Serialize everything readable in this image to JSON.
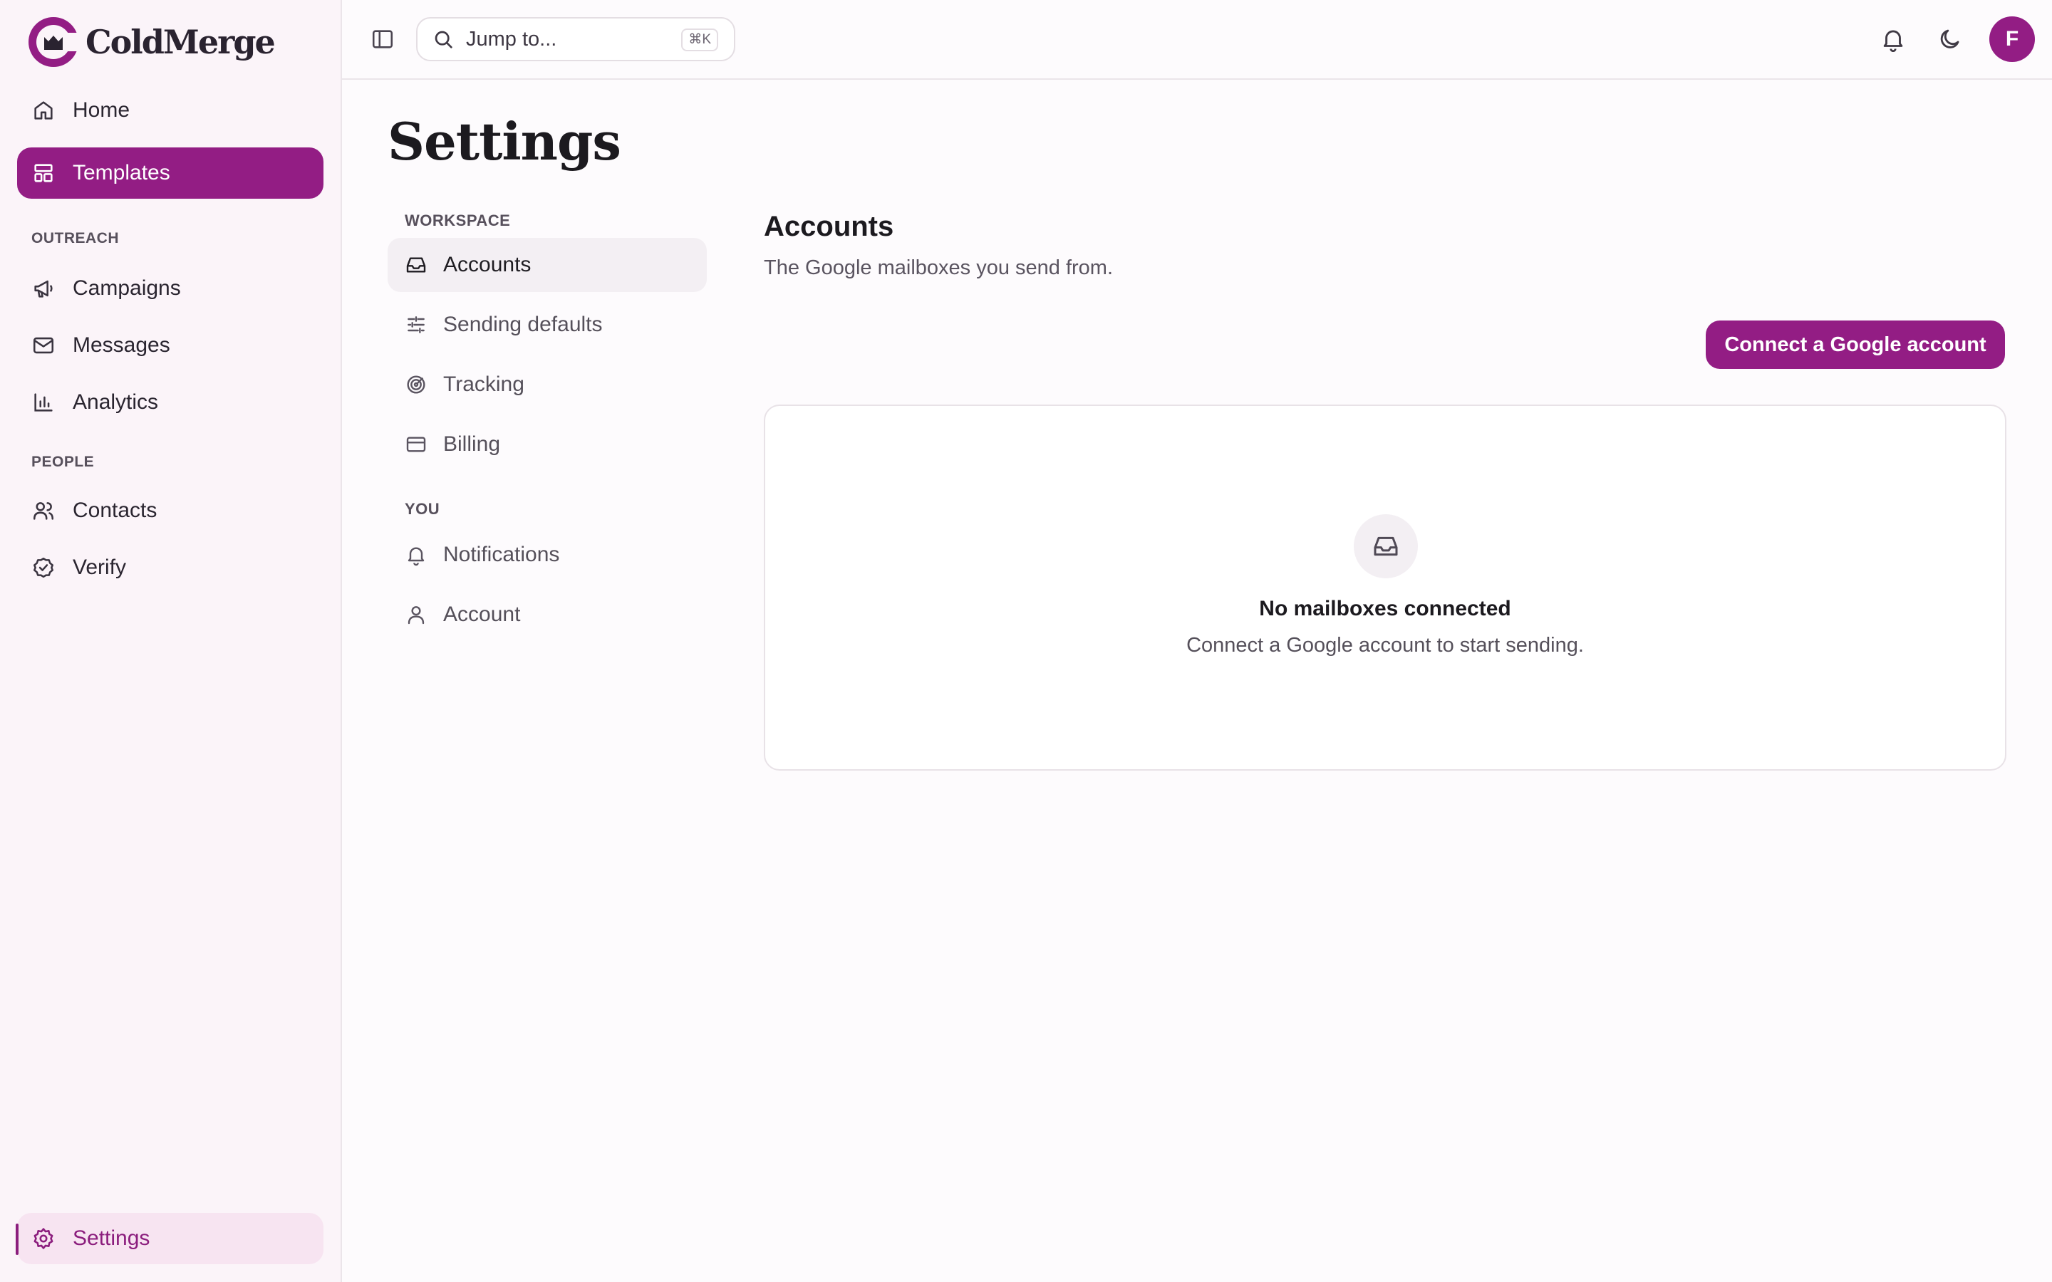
{
  "brand": {
    "name": "ColdMerge"
  },
  "sidebar": {
    "items": [
      {
        "label": "Home",
        "icon": "home-icon"
      },
      {
        "label": "Templates",
        "icon": "layout-icon"
      },
      {
        "label": "Campaigns",
        "icon": "megaphone-icon"
      },
      {
        "label": "Messages",
        "icon": "mail-icon"
      },
      {
        "label": "Analytics",
        "icon": "bar-chart-icon"
      },
      {
        "label": "Contacts",
        "icon": "users-icon"
      },
      {
        "label": "Verify",
        "icon": "check-badge-icon"
      },
      {
        "label": "Settings",
        "icon": "gear-icon"
      }
    ],
    "sections": {
      "outreach": "OUTREACH",
      "people": "PEOPLE"
    }
  },
  "topbar": {
    "search_placeholder": "Jump to...",
    "shortcut": "⌘K",
    "avatar_initial": "F"
  },
  "page": {
    "title": "Settings"
  },
  "settings_nav": {
    "workspace_label": "WORKSPACE",
    "you_label": "YOU",
    "items": [
      {
        "label": "Accounts",
        "icon": "inbox-icon"
      },
      {
        "label": "Sending defaults",
        "icon": "sliders-icon"
      },
      {
        "label": "Tracking",
        "icon": "target-icon"
      },
      {
        "label": "Billing",
        "icon": "credit-card-icon"
      },
      {
        "label": "Notifications",
        "icon": "bell-icon"
      },
      {
        "label": "Account",
        "icon": "user-icon"
      }
    ]
  },
  "accounts": {
    "title": "Accounts",
    "description": "The Google mailboxes you send from.",
    "connect_button": "Connect a Google account",
    "empty_title": "No mailboxes connected",
    "empty_description": "Connect a Google account to start sending."
  },
  "colors": {
    "accent": "#931d84",
    "sidebar_bg": "#fbf4f9",
    "active_soft": "#f7e4f1"
  }
}
